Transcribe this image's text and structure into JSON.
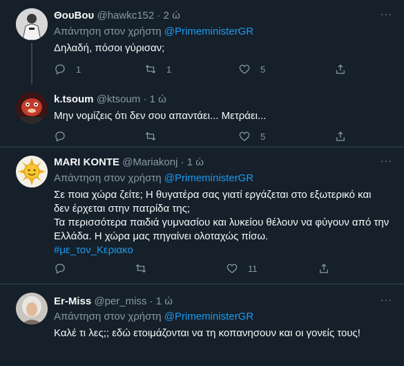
{
  "tweets": [
    {
      "name": "ΘουΒου",
      "handle": "@hawkc152",
      "time": "2 ώ",
      "reply_prefix": "Απάντηση στον χρήστη",
      "reply_mention": "@PrimeministerGR",
      "text": [
        "Δηλαδή, πόσοι γύρισαν;"
      ],
      "counts": {
        "reply": "1",
        "retweet": "1",
        "like": "5"
      }
    },
    {
      "name": "k.tsoum",
      "handle": "@ktsoum",
      "time": "1 ώ",
      "text": [
        "Μην νομίζεις ότι δεν σου απαντάει... Μετράει..."
      ],
      "counts": {
        "like": "5"
      }
    },
    {
      "name": "MARI KONTE",
      "handle": "@Mariakonj",
      "time": "1 ώ",
      "reply_prefix": "Απάντηση στον χρήστη",
      "reply_mention": "@PrimeministerGR",
      "text": [
        "Σε ποια χώρα ζείτε; Η θυγατέρα σας γιατί εργάζεται στο εξωτερικό και",
        "δεν έρχεται στην πατρίδα της;",
        "Τα περισσότερα παιδιά γυμνασίου και λυκείου θέλουν να φύγουν από την",
        "Ελλάδα. Η χώρα μας πηγαίνει ολοταχώς πίσω."
      ],
      "hashtag": "#με_τον_Κεριακο",
      "counts": {
        "like": "11"
      }
    },
    {
      "name": "Er-Miss",
      "handle": "@per_miss",
      "time": "1 ώ",
      "reply_prefix": "Απάντηση στον χρήστη",
      "reply_mention": "@PrimeministerGR",
      "text": [
        "Καλέ τι λες;; εδώ ετοιμάζονται να τη κοπανησουν και οι γονείς τους!"
      ]
    }
  ],
  "separator_dot": "·",
  "more_label": "···",
  "icons": [
    "reply-icon",
    "retweet-icon",
    "like-icon",
    "share-icon",
    "more-icon"
  ],
  "colors": {
    "background": "#15202b",
    "accent": "#1d9bf0",
    "muted": "#8b98a5",
    "text": "#f7f9f9"
  }
}
